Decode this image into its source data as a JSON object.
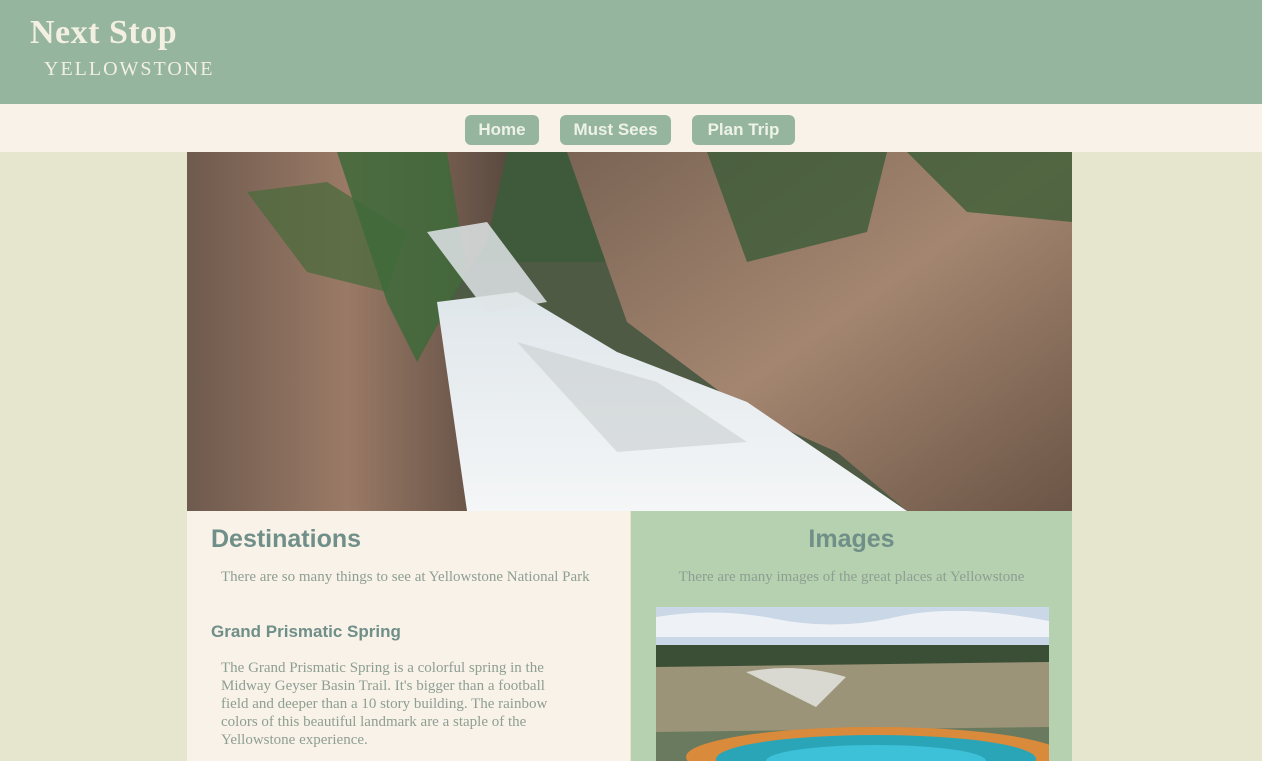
{
  "header": {
    "title": "Next Stop",
    "subtitle": "YELLOWSTONE"
  },
  "nav": {
    "items": [
      {
        "label": "Home"
      },
      {
        "label": "Must Sees"
      },
      {
        "label": "Plan Trip"
      }
    ]
  },
  "hero": {
    "alt": "Waterfall in Yellowstone canyon"
  },
  "destinations": {
    "heading": "Destinations",
    "intro": "There are so many things to see at Yellowstone National Park",
    "spring_heading": "Grand Prismatic Spring",
    "spring_text": "The Grand Prismatic Spring is a colorful spring in the Midway Geyser Basin Trail. It's bigger than a football field and deeper than a 10 story building. The rainbow colors of this beautiful landmark are a staple of the Yellowstone experience."
  },
  "images": {
    "heading": "Images",
    "intro": "There are many images of the great places at Yellowstone",
    "thumb_alt": "Grand Prismatic Spring"
  },
  "colors": {
    "header_bg": "#95b59f",
    "nav_bg": "#f8f2e9",
    "page_bg": "#e6e6cf",
    "images_bg": "#b5d1b0",
    "heading_text": "#6f8f88"
  }
}
